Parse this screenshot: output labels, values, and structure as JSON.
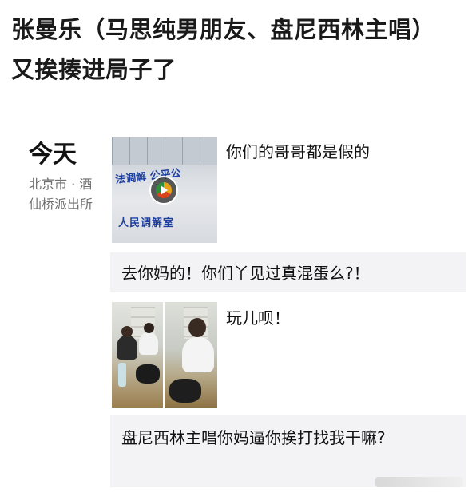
{
  "headline": "张曼乐（马思纯男朋友、盘尼西林主唱）又挨揍进局子了",
  "moments": {
    "day": "今天",
    "location": "北京市 · 酒仙桥派出所",
    "posts": [
      {
        "media_type": "video",
        "thumbnail_text_top": "法调解  公平公",
        "thumbnail_text_bottom": "人民调解室",
        "text": "你们的哥哥都是假的"
      },
      {
        "media_type": "photos",
        "photo_count": 2,
        "text": "玩儿呗！"
      }
    ],
    "comments": [
      "去你妈的！你们丫见过真混蛋么?！",
      "盘尼西林主唱你妈逼你挨打找我干嘛?"
    ]
  },
  "colors": {
    "comment_bg": "#f3f3f5",
    "location_text": "#6f6f6f",
    "banner_blue": "#1d3fa0"
  },
  "icons": [
    "play-icon"
  ]
}
